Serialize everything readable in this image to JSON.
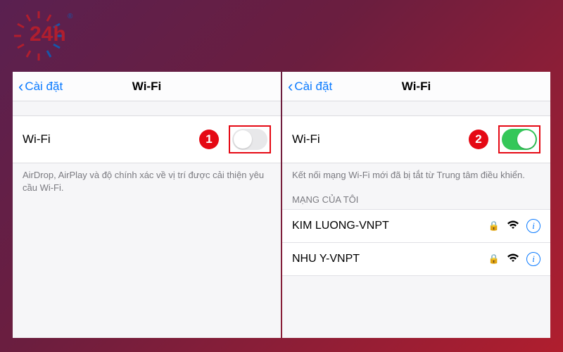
{
  "logo": {
    "text": "24h",
    "reg": "®"
  },
  "markers": {
    "left": "1",
    "right": "2"
  },
  "left": {
    "back": "Cài đặt",
    "title": "Wi-Fi",
    "row_label": "Wi-Fi",
    "switch_on": false,
    "help": "AirDrop, AirPlay và độ chính xác về vị trí được cải thiện yêu cầu Wi-Fi."
  },
  "right": {
    "back": "Cài đặt",
    "title": "Wi-Fi",
    "row_label": "Wi-Fi",
    "switch_on": true,
    "help": "Kết nối mạng Wi-Fi mới đã bị tắt từ Trung tâm điều khiển.",
    "section": "MẠNG CỦA TÔI",
    "networks": [
      {
        "name": "KIM LUONG-VNPT"
      },
      {
        "name": "NHU Y-VNPT"
      }
    ]
  }
}
